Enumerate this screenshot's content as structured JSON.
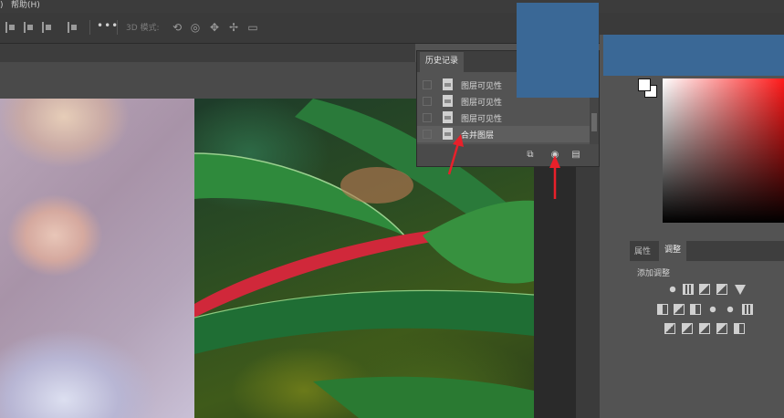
{
  "menubar": {
    "left_fragment": ")",
    "help_menu": "帮助(H)"
  },
  "options_bar": {
    "more_label": "•••",
    "mode_3d_label": "3D 模式:"
  },
  "history_panel": {
    "tab_label": "历史记录",
    "items": [
      {
        "label": "图层可见性"
      },
      {
        "label": "图层可见性"
      },
      {
        "label": "图层可见性"
      },
      {
        "label": "合并图层"
      }
    ]
  },
  "right_panel": {
    "tab_properties": "属性",
    "tab_adjustments": "调整",
    "add_adjustment_label": "添加调整"
  },
  "colors": {
    "overlay_blue": "#3a6896",
    "arrow_red": "#e8202a",
    "panel_bg": "#535353"
  },
  "icons": [
    "align-icons",
    "more-icon",
    "3d-orbit-icon",
    "camera-icon",
    "new-document-from-state-icon",
    "new-snapshot-icon",
    "trash-icon",
    "adjustment-icons"
  ]
}
